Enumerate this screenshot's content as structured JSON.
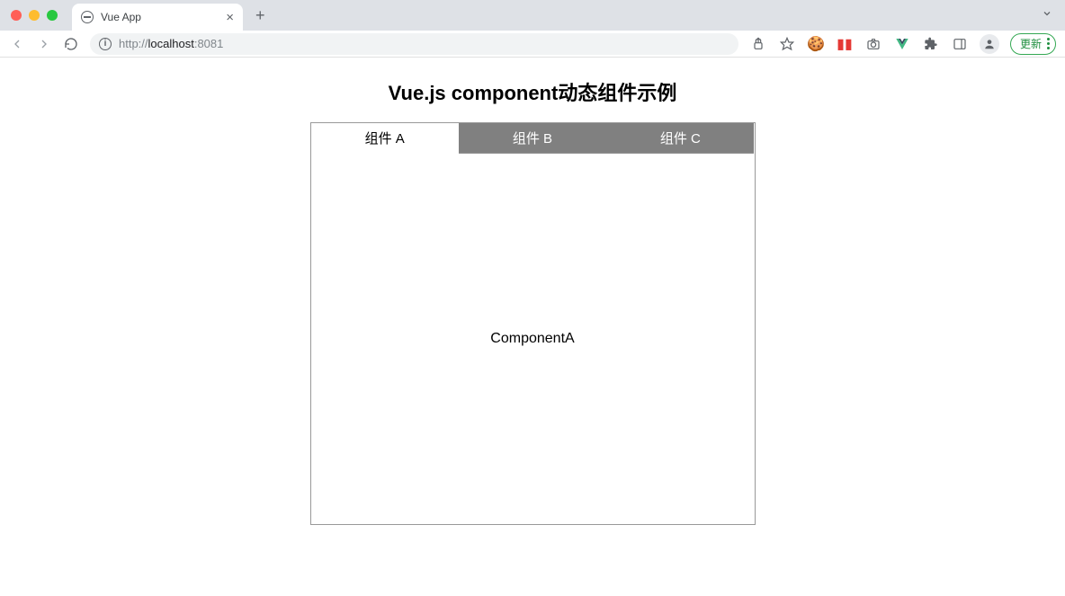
{
  "browser": {
    "tab_title": "Vue App",
    "close_glyph": "×",
    "new_tab_glyph": "+",
    "url_scheme": "http://",
    "url_host": "localhost",
    "url_port": ":8081",
    "update_label": "更新"
  },
  "page": {
    "title": "Vue.js component动态组件示例",
    "tabs": [
      {
        "label": "组件 A",
        "active": true
      },
      {
        "label": "组件 B",
        "active": false
      },
      {
        "label": "组件 C",
        "active": false
      }
    ],
    "body_text": "ComponentA"
  }
}
